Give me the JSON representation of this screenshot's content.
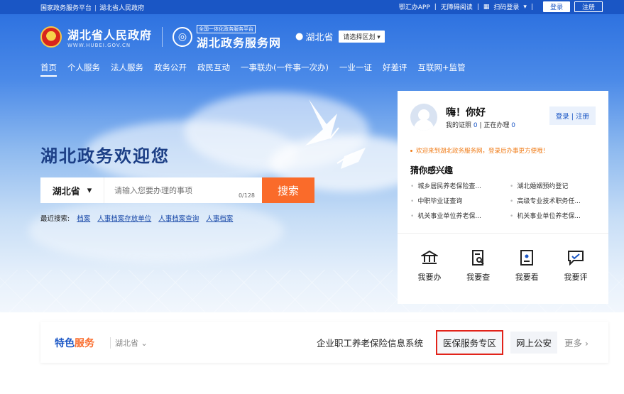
{
  "topbar": {
    "left": [
      "国家政务服务平台",
      "湖北省人民政府"
    ],
    "app": "鄂汇办APP",
    "accessibility": "无障碍阅读",
    "scan_login": "扫码登录",
    "login": "登录",
    "register": "注册"
  },
  "header": {
    "gov_name": "湖北省人民政府",
    "gov_url": "WWW.HUBEI.GOV.CN",
    "service_platform_tag": "全国一体化政务服务平台",
    "service_name": "湖北政务服务网",
    "location": "湖北省",
    "region_select": "请选择区划"
  },
  "nav": [
    "首页",
    "个人服务",
    "法人服务",
    "政务公开",
    "政民互动",
    "一事联办(一件事一次办)",
    "一业一证",
    "好差评",
    "互联网+监管"
  ],
  "hero": {
    "welcome": "湖北政务欢迎您",
    "search_province": "湖北省",
    "search_placeholder": "请输入您要办理的事项",
    "search_counter": "0/128",
    "search_button": "搜索",
    "recent_label": "最近搜索:",
    "recent": [
      "档案",
      "人事档案存放单位",
      "人事档案查询",
      "人事档案"
    ]
  },
  "panel": {
    "greeting": "嗨！你好",
    "license_label": "我的证照",
    "license_count": "0",
    "processing_label": "正在办理",
    "processing_count": "0",
    "auth_login": "登录",
    "auth_register": "注册",
    "notice": "欢迎来到湖北政务服务网，登录后办事更方便哦！",
    "interest_title": "猜你感兴趣",
    "interest_items": [
      "城乡居民养老保险查...",
      "湖北婚姻预约登记",
      "中职毕业证查询",
      "高级专业技术职务任...",
      "机关事业单位养老保...",
      "机关事业单位养老保..."
    ],
    "actions": [
      {
        "label": "我要办",
        "icon": "bank-icon"
      },
      {
        "label": "我要查",
        "icon": "query-doc-icon"
      },
      {
        "label": "我要看",
        "icon": "view-doc-icon"
      },
      {
        "label": "我要评",
        "icon": "comment-icon"
      }
    ]
  },
  "strip": {
    "title_a": "特色",
    "title_b": "服务",
    "province": "湖北省",
    "links": [
      "企业职工养老保险信息系统",
      "医保服务专区",
      "网上公安"
    ],
    "more": "更多"
  },
  "colors": {
    "brand_blue": "#1a56c5",
    "search_orange": "#fa6b2a",
    "highlight_red": "#e2231a"
  }
}
